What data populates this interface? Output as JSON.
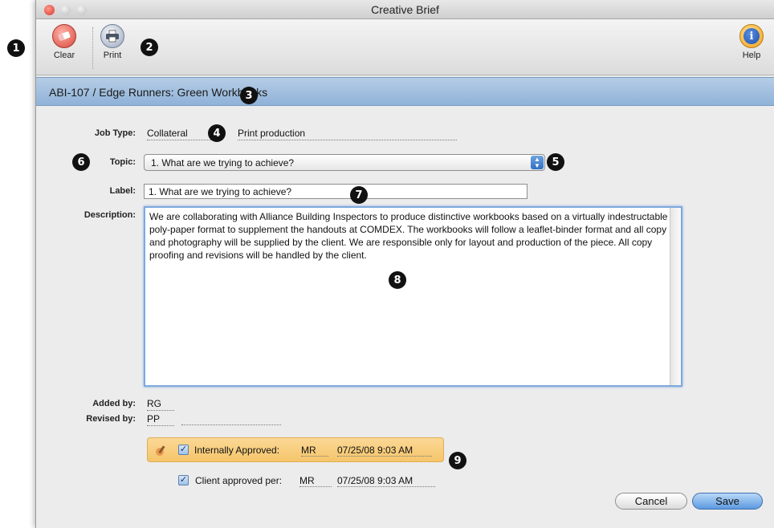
{
  "window": {
    "title": "Creative Brief",
    "traffic_lights": [
      "close",
      "minimize",
      "zoom"
    ]
  },
  "toolbar": {
    "clear_label": "Clear",
    "print_label": "Print",
    "help_label": "Help"
  },
  "banner": {
    "text": "ABI-107 / Edge Runners: Green Workbooks"
  },
  "form": {
    "job_type_label": "Job Type:",
    "job_type_value": "Collateral",
    "job_type_extra": "Print production",
    "topic_label": "Topic:",
    "topic_value": "1.  What are we trying to achieve?",
    "label_label": "Label:",
    "label_value": "1.  What are we trying to achieve?",
    "description_label": "Description:",
    "description_value": "We are collaborating with Alliance Building Inspectors to produce distinctive workbooks based on a virtually indestructable poly-paper format to supplement the handouts at COMDEX. The workbooks will follow a leaflet-binder format and all copy and photography will be supplied by the client. We are responsible only for layout and production of the piece. All copy proofing and revisions will be handled by the client.",
    "added_by_label": "Added by:",
    "added_by_value": "RG",
    "revised_by_label": "Revised by:",
    "revised_by_value": "PP"
  },
  "approval": {
    "internal_label": "Internally Approved:",
    "internal_by": "MR",
    "internal_date": "07/25/08 9:03 AM",
    "internal_checked": true,
    "client_label": "Client approved per:",
    "client_by": "MR",
    "client_date": "07/25/08 9:03 AM",
    "client_checked": true
  },
  "buttons": {
    "cancel_label": "Cancel",
    "save_label": "Save"
  },
  "callouts": {
    "c1": "1",
    "c2": "2",
    "c3": "3",
    "c4": "4",
    "c5": "5",
    "c6": "6",
    "c7": "7",
    "c8": "8",
    "c9": "9"
  },
  "colors": {
    "banner": "#9fbfe0",
    "approval_highlight": "#f7cb75",
    "default_button": "#6fa7e6"
  }
}
